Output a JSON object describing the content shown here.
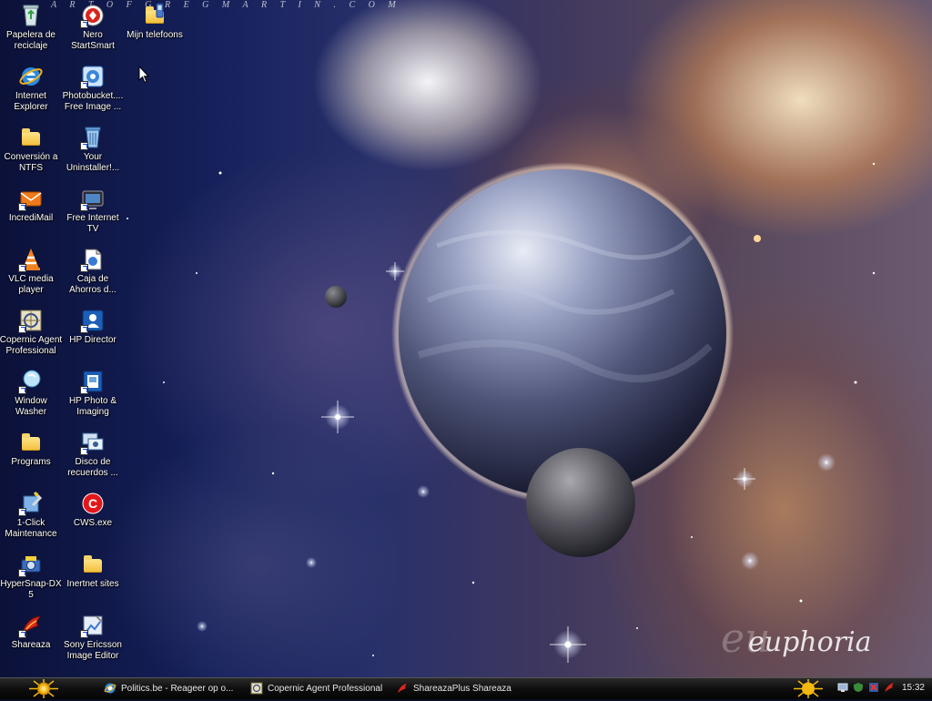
{
  "wallpaper": {
    "watermark_top": "A R T  O F  G R E G  M A R T I N . C O M",
    "signature": "euphoria",
    "colors": {
      "planet": "#5a5f80",
      "nebula_glow": "#f4c88a",
      "space": "#0b1138"
    }
  },
  "desktop_icons": [
    {
      "label": "Papelera de reciclaje",
      "icon": "recycle-bin-icon"
    },
    {
      "label": "Nero StartSmart",
      "icon": "nero-icon"
    },
    {
      "label": "Mijn telefoons",
      "icon": "phone-folder-icon"
    },
    {
      "label": "Internet Explorer",
      "icon": "internet-explorer-icon"
    },
    {
      "label": "Photobucket.... Free Image ...",
      "icon": "photobucket-icon"
    },
    {
      "label": "Conversión a NTFS",
      "icon": "folder-icon"
    },
    {
      "label": "Your Uninstaller!...",
      "icon": "uninstaller-icon"
    },
    {
      "label": "IncrediMail",
      "icon": "incredimail-icon"
    },
    {
      "label": "Free Internet TV",
      "icon": "tv-icon"
    },
    {
      "label": "VLC media player",
      "icon": "vlc-icon"
    },
    {
      "label": "Caja de Ahorros d...",
      "icon": "document-icon"
    },
    {
      "label": "Copernic Agent Professional",
      "icon": "copernic-icon"
    },
    {
      "label": "HP Director",
      "icon": "hp-director-icon"
    },
    {
      "label": "Window Washer",
      "icon": "window-washer-icon"
    },
    {
      "label": "HP Photo & Imaging",
      "icon": "hp-photo-icon"
    },
    {
      "label": "Programs",
      "icon": "folder-icon"
    },
    {
      "label": "Disco de recuerdos ...",
      "icon": "disc-icon"
    },
    {
      "label": "1-Click Maintenance",
      "icon": "maintenance-icon"
    },
    {
      "label": "CWS.exe",
      "icon": "cws-icon"
    },
    {
      "label": "HyperSnap-DX 5",
      "icon": "hypersnap-icon"
    },
    {
      "label": "Inertnet sites",
      "icon": "folder-icon"
    },
    {
      "label": "Shareaza",
      "icon": "shareaza-icon"
    },
    {
      "label": "Sony Ericsson Image Editor",
      "icon": "sony-ericsson-icon"
    }
  ],
  "taskbar": {
    "tasks": [
      {
        "label": "Politics.be - Reageer op o...",
        "icon": "internet-explorer-icon"
      },
      {
        "label": "Copernic Agent Professional",
        "icon": "copernic-icon"
      },
      {
        "label": "ShareazaPlus Shareaza",
        "icon": "shareaza-icon"
      }
    ],
    "clock": "15:32",
    "tray_icons": [
      "network-icon",
      "shield-icon",
      "antivirus-icon",
      "shareaza-tray-icon"
    ]
  }
}
